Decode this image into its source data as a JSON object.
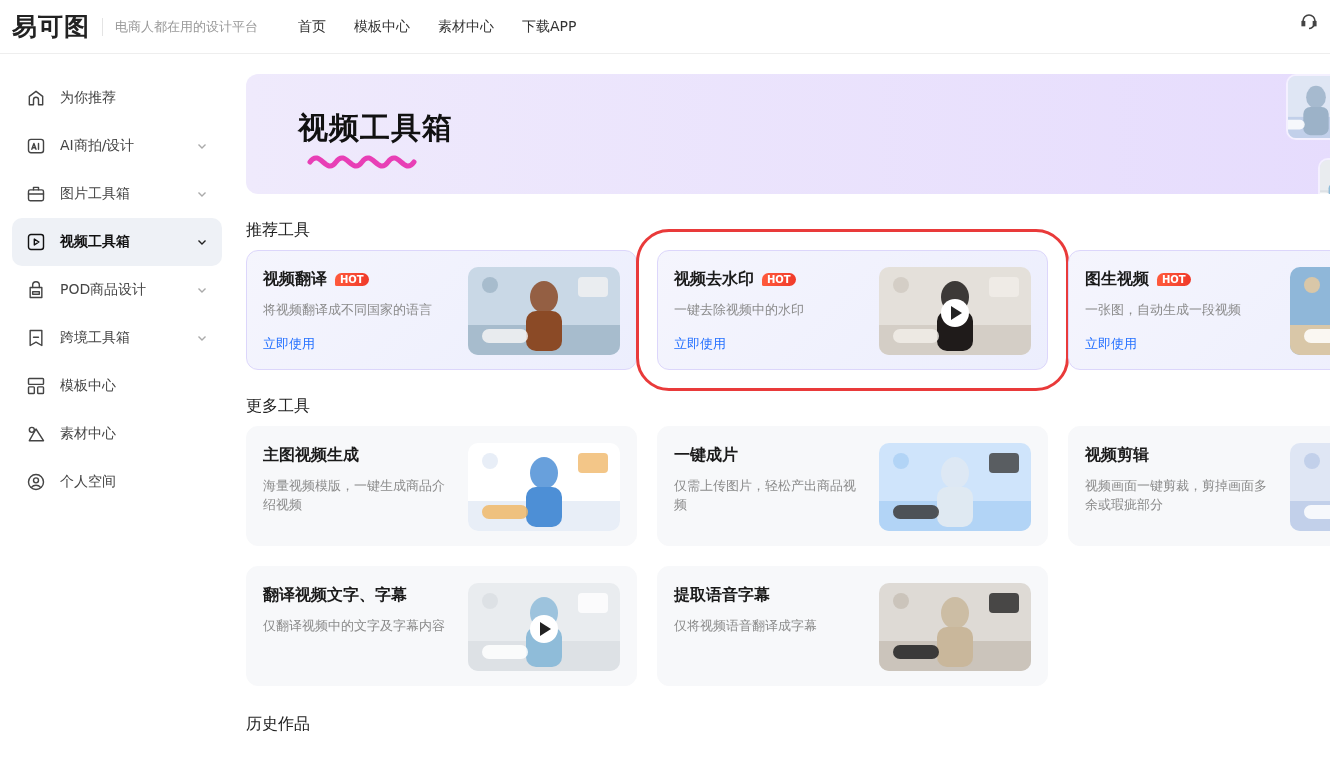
{
  "header": {
    "logo": "易可图",
    "slogan": "电商人都在用的设计平台",
    "nav": [
      {
        "label": "首页"
      },
      {
        "label": "模板中心"
      },
      {
        "label": "素材中心"
      },
      {
        "label": "下载APP"
      }
    ]
  },
  "sidebar": {
    "items": [
      {
        "label": "为你推荐",
        "selected": false,
        "has_submenu": false
      },
      {
        "label": "AI商拍/设计",
        "selected": false,
        "has_submenu": true
      },
      {
        "label": "图片工具箱",
        "selected": false,
        "has_submenu": true
      },
      {
        "label": "视频工具箱",
        "selected": true,
        "has_submenu": true
      },
      {
        "label": "POD商品设计",
        "selected": false,
        "has_submenu": true
      },
      {
        "label": "跨境工具箱",
        "selected": false,
        "has_submenu": true
      },
      {
        "label": "模板中心",
        "selected": false,
        "has_submenu": false
      },
      {
        "label": "素材中心",
        "selected": false,
        "has_submenu": false
      },
      {
        "label": "个人空间",
        "selected": false,
        "has_submenu": false
      }
    ]
  },
  "banner": {
    "title": "视频工具箱"
  },
  "recommended": {
    "heading": "推荐工具",
    "cards": [
      {
        "title": "视频翻译",
        "badge": "HOT",
        "description": "将视频翻译成不同国家的语言",
        "link": "立即使用",
        "highlighted": false
      },
      {
        "title": "视频去水印",
        "badge": "HOT",
        "description": "一键去除视频中的水印",
        "link": "立即使用",
        "highlighted": true
      },
      {
        "title": "图生视频",
        "badge": "HOT",
        "description": "一张图，自动生成一段视频",
        "link": "立即使用",
        "highlighted": false
      }
    ]
  },
  "more_tools": {
    "heading": "更多工具",
    "cards": [
      {
        "title": "主图视频生成",
        "description": "海量视频模版，一键生成商品介绍视频"
      },
      {
        "title": "一键成片",
        "description": "仅需上传图片，轻松产出商品视频"
      },
      {
        "title": "视频剪辑",
        "description": "视频画面一键剪裁，剪掉画面多余或瑕疵部分"
      },
      {
        "title": "翻译视频文字、字幕",
        "description": "仅翻译视频中的文字及字幕内容"
      },
      {
        "title": "提取语音字幕",
        "description": "仅将视频语音翻译成字幕"
      }
    ]
  },
  "history": {
    "heading": "历史作品"
  }
}
